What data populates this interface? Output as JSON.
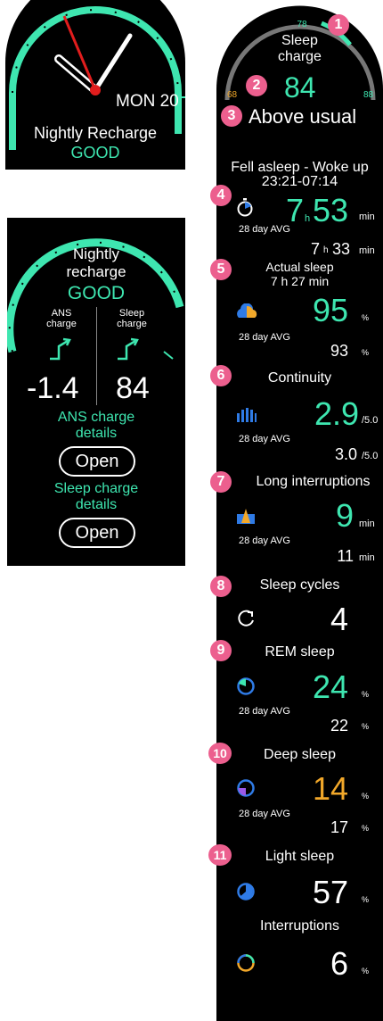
{
  "watch1": {
    "date": "MON 20",
    "title": "Nightly Recharge",
    "status": "GOOD"
  },
  "watch2": {
    "title_line1": "Nightly",
    "title_line2": "recharge",
    "status": "GOOD",
    "ans_label_line1": "ANS",
    "ans_label_line2": "charge",
    "sleep_label_line1": "Sleep",
    "sleep_label_line2": "charge",
    "ans_value": "-1.4",
    "sleep_value": "84",
    "ans_details_line1": "ANS charge",
    "ans_details_line2": "details",
    "open_label": "Open",
    "sleep_details_line1": "Sleep charge",
    "sleep_details_line2": "details",
    "open_label_2": "Open"
  },
  "watch3": {
    "gauge_top": "78",
    "gauge_left": "68",
    "gauge_right": "88",
    "sleep_charge_line1": "Sleep",
    "sleep_charge_line2": "charge",
    "sleep_charge_value": "84",
    "sleep_charge_status": "Above usual",
    "fell_asleep_label": "Fell asleep - Woke up",
    "fell_asleep_time": "23:21-07:14",
    "duration": {
      "hours": "7",
      "h": "h",
      "minutes": "53",
      "unit": "min",
      "avg_label": "28 day AVG",
      "avg_hours": "7",
      "avg_h": "h",
      "avg_minutes": "33",
      "avg_unit": "min"
    },
    "actual_sleep_label": "Actual sleep",
    "actual_sleep_value": "7 h 27 min",
    "actual": {
      "value": "95",
      "unit": "%",
      "avg_label": "28 day AVG",
      "avg_value": "93",
      "avg_unit": "%"
    },
    "continuity_label": "Continuity",
    "continuity": {
      "value": "2.9",
      "unit": "/5.0",
      "avg_label": "28 day AVG",
      "avg_value": "3.0",
      "avg_unit": "/5.0"
    },
    "long_interruptions_label": "Long interruptions",
    "long_int": {
      "value": "9",
      "unit": "min",
      "avg_label": "28 day AVG",
      "avg_value": "11",
      "avg_unit": "min"
    },
    "cycles_label": "Sleep cycles",
    "cycles_value": "4",
    "rem_label": "REM sleep",
    "rem": {
      "value": "24",
      "unit": "%",
      "avg_label": "28 day AVG",
      "avg_value": "22",
      "avg_unit": "%"
    },
    "deep_label": "Deep sleep",
    "deep": {
      "value": "14",
      "unit": "%",
      "avg_label": "28 day AVG",
      "avg_value": "17",
      "avg_unit": "%"
    },
    "light_label": "Light sleep",
    "light": {
      "value": "57",
      "unit": "%"
    },
    "interruptions_label": "Interruptions",
    "interruptions": {
      "value": "6",
      "unit": "%"
    }
  },
  "badges": [
    "1",
    "2",
    "3",
    "4",
    "5",
    "6",
    "7",
    "8",
    "9",
    "10",
    "11"
  ],
  "colors": {
    "accent": "#3ee6b0",
    "orange": "#f2a82a",
    "badge": "#ec5f8e"
  }
}
